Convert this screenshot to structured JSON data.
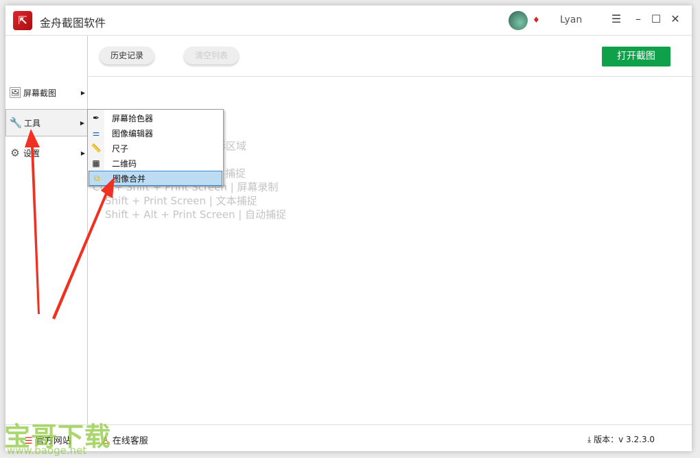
{
  "titlebar": {
    "app_title": "金舟截图软件",
    "username": "Lyan",
    "menu_icon": "hamburger-icon",
    "minimize_icon": "minimize-icon",
    "maximize_icon": "maximize-icon",
    "close_icon": "close-icon"
  },
  "toolbar": {
    "history": "历史记录",
    "clear_list": "清空列表",
    "open_capture": "打开截图"
  },
  "sidebar": {
    "items": [
      {
        "label": "屏幕截图",
        "icon": "image-icon"
      },
      {
        "label": "工具",
        "icon": "wrench-icon"
      },
      {
        "label": "设置",
        "icon": "gear-icon"
      }
    ]
  },
  "submenu": {
    "items": [
      {
        "label": "屏幕拾色器",
        "icon": "eyedropper-icon"
      },
      {
        "label": "图像编辑器",
        "icon": "sliders-icon"
      },
      {
        "label": "尺子",
        "icon": "ruler-icon"
      },
      {
        "label": "二维码",
        "icon": "qrcode-icon"
      },
      {
        "label": "图像合并",
        "icon": "merge-icon"
      }
    ],
    "selected": "图像合并"
  },
  "hints": [
    "形区域",
    "捕捉",
    "Ctrl + Shift + Print Screen  |  屏幕录制",
    "Shift + Print Screen  |  文本捕捉",
    "Shift + Alt + Print Screen  |  自动捕捉"
  ],
  "footer": {
    "website": "官方网站",
    "support": "在线客服",
    "version": "版本：v 3.2.3.0"
  },
  "watermark": {
    "title": "宝哥下载",
    "url": "www.baoge.net"
  },
  "colors": {
    "primary": "#0fa14a",
    "selection": "#bcdcf4",
    "arrow": "#f03020"
  }
}
